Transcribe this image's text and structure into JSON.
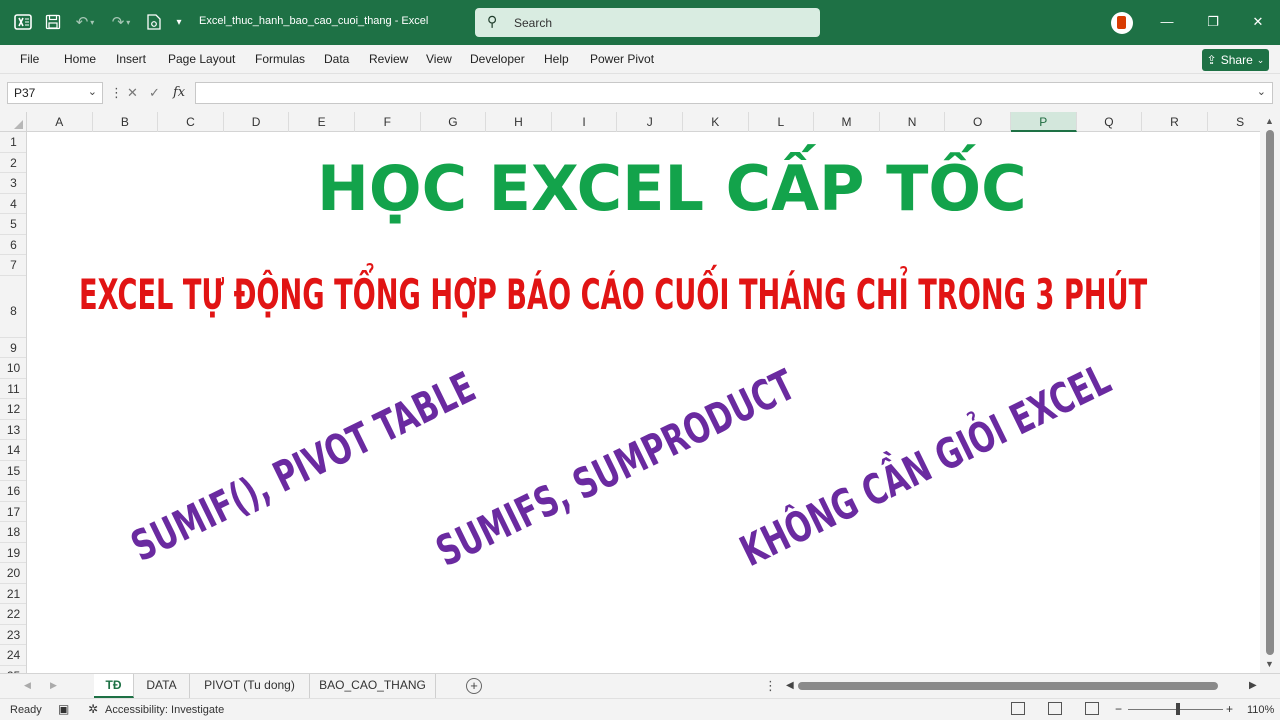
{
  "titlebar": {
    "doc_title": "Excel_thuc_hanh_bao_cao_cuoi_thang  -  Excel",
    "search_placeholder": "Search",
    "undo_icon": "undo-icon",
    "redo_icon": "redo-icon"
  },
  "ribbon": {
    "tabs": [
      "File",
      "Home",
      "Insert",
      "Page Layout",
      "Formulas",
      "Data",
      "Review",
      "View",
      "Developer",
      "Help",
      "Power Pivot"
    ],
    "share_label": "Share"
  },
  "formula_bar": {
    "name_box": "P37",
    "fx_label": "fx",
    "formula": ""
  },
  "grid": {
    "columns": [
      "A",
      "B",
      "C",
      "D",
      "E",
      "F",
      "G",
      "H",
      "I",
      "J",
      "K",
      "L",
      "M",
      "N",
      "O",
      "P",
      "Q",
      "R",
      "S"
    ],
    "selected_column": "P",
    "rows": [
      "1",
      "2",
      "3",
      "4",
      "5",
      "6",
      "7",
      "8",
      "9",
      "10",
      "11",
      "12",
      "13",
      "14",
      "15",
      "16",
      "17",
      "18",
      "19",
      "20",
      "21",
      "22",
      "23",
      "24",
      "25"
    ]
  },
  "content": {
    "title": "HỌC EXCEL CẤP TỐC",
    "subtitle": "EXCEL TỰ ĐỘNG TỔNG HỢP BÁO CÁO CUỐI THÁNG CHỈ TRONG 3 PHÚT",
    "feature_1": "SUMIF(), PIVOT TABLE",
    "feature_2": "SUMIFS, SUMPRODUCT",
    "feature_3": "KHÔNG CẦN GIỎI EXCEL",
    "title_color": "#13a34b",
    "subtitle_color": "#e11414",
    "feature_color": "#6a2aa0"
  },
  "sheets": {
    "tabs": [
      "TĐ",
      "DATA",
      "PIVOT (Tu dong)",
      "BAO_CAO_THANG"
    ],
    "active": "TĐ"
  },
  "status": {
    "ready": "Ready",
    "accessibility": "Accessibility: Investigate",
    "zoom": "110%"
  },
  "colors": {
    "excel_green": "#1e7145"
  }
}
